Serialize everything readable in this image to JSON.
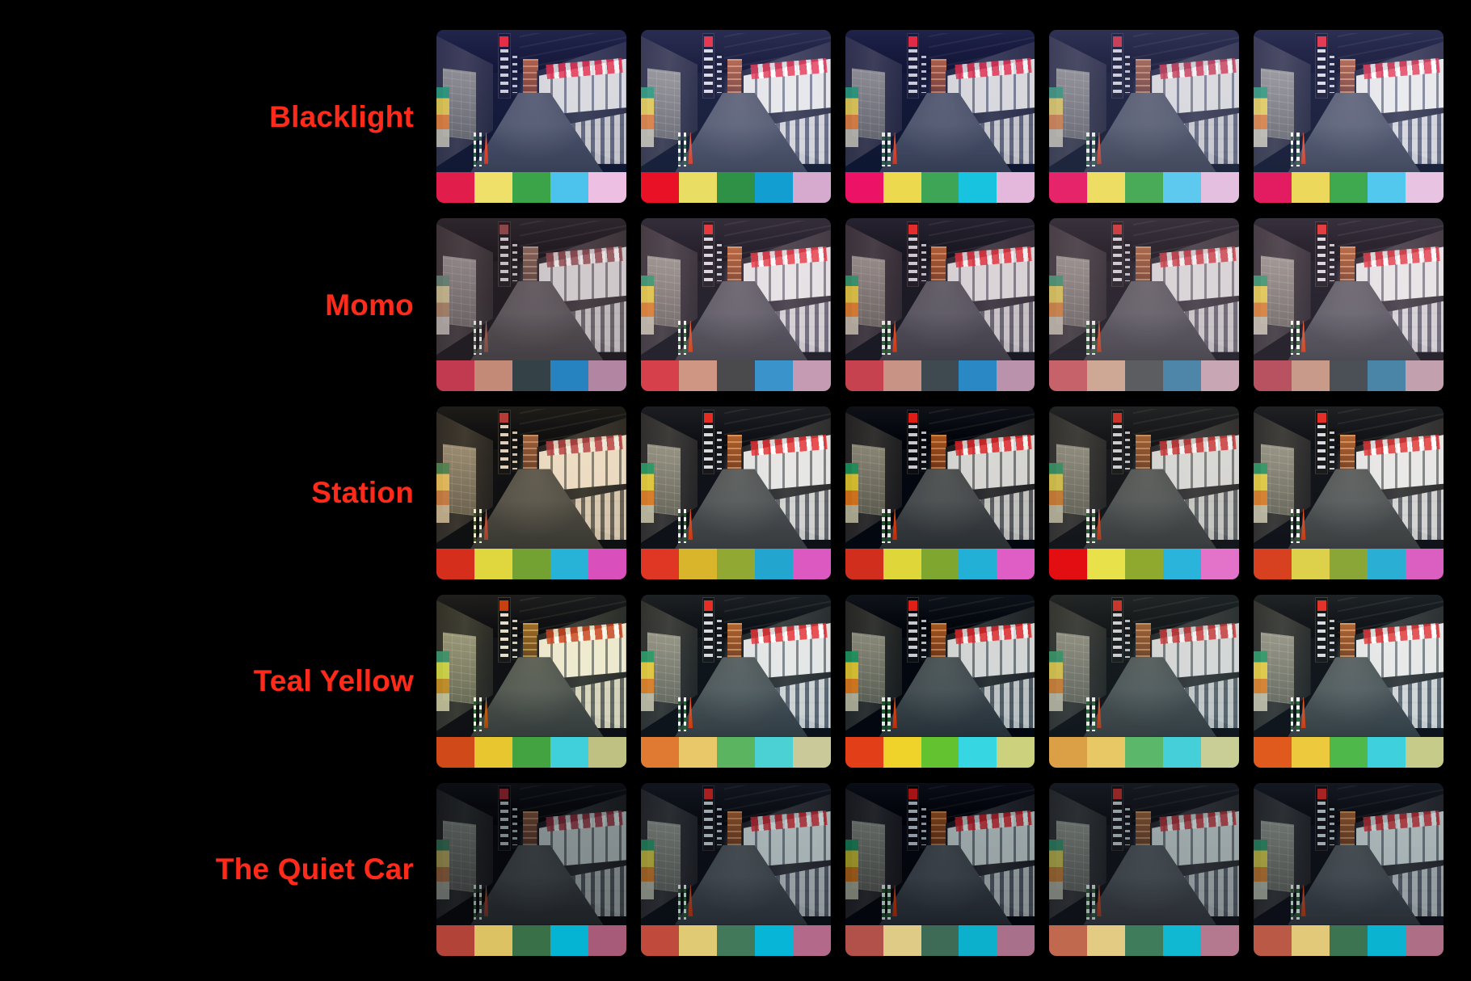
{
  "page": {
    "title": "Colour Preset Comparison Grid",
    "background_color": "#000000",
    "label_color": "#ff2a1a",
    "columns": 5,
    "rows": 5
  },
  "photo": {
    "subject": "japanese-shopping-arcade-alley-at-night",
    "description": "Narrow covered shopping street at night with vertical Japanese signage, shuttered storefronts, traffic cones and a wet asphalt road receding to a lit vanishing point."
  },
  "presets": [
    {
      "label": "Blacklight",
      "id": "blacklight",
      "row_class": "row-blacklight",
      "variants": [
        {
          "swatches": [
            "#e01d4b",
            "#efe069",
            "#3ba348",
            "#4cc3ec",
            "#edbfe3"
          ]
        },
        {
          "swatches": [
            "#e81126",
            "#e9dd63",
            "#2f9145",
            "#129ed1",
            "#d6aace"
          ]
        },
        {
          "swatches": [
            "#ec1266",
            "#edd94e",
            "#3da555",
            "#18c3e0",
            "#e3b8dc"
          ]
        },
        {
          "swatches": [
            "#e5246a",
            "#eedd63",
            "#49ab57",
            "#5ec9ef",
            "#e5bfe0"
          ]
        },
        {
          "swatches": [
            "#e31c62",
            "#ecd95c",
            "#3fa94f",
            "#52c8ee",
            "#e9c3e2"
          ]
        }
      ]
    },
    {
      "label": "Momo",
      "id": "momo",
      "row_class": "row-momo",
      "variants": [
        {
          "swatches": [
            "#c23a50",
            "#c28a77",
            "#344247",
            "#2683bf",
            "#b286a3"
          ]
        },
        {
          "swatches": [
            "#d6404a",
            "#cf9684",
            "#4a4a4c",
            "#3b93cc",
            "#c49bb2"
          ]
        },
        {
          "swatches": [
            "#c7424f",
            "#c89384",
            "#3e4a50",
            "#2a88c4",
            "#bb92ab"
          ]
        },
        {
          "swatches": [
            "#c5626a",
            "#cfa795",
            "#5c5d60",
            "#4d86a9",
            "#c9a6b4"
          ]
        },
        {
          "swatches": [
            "#b85260",
            "#c79a8a",
            "#4a5055",
            "#4a84a6",
            "#c2a0ad"
          ]
        }
      ]
    },
    {
      "label": "Station",
      "id": "station",
      "row_class": "row-station",
      "variants": [
        {
          "swatches": [
            "#d62e1d",
            "#e0d63e",
            "#74a232",
            "#27b2d8",
            "#d94fbc"
          ]
        },
        {
          "swatches": [
            "#e03624",
            "#d9b52c",
            "#91a832",
            "#22a5cf",
            "#dd59c2"
          ]
        },
        {
          "swatches": [
            "#d22e1e",
            "#dfd63a",
            "#7fa62f",
            "#22b0d6",
            "#df5ec6"
          ]
        },
        {
          "swatches": [
            "#e20e12",
            "#e8e14a",
            "#8fa82e",
            "#2ab4dc",
            "#e273c9"
          ]
        },
        {
          "swatches": [
            "#d7411f",
            "#ddd04a",
            "#8aa636",
            "#2aaed4",
            "#da5fc0"
          ]
        }
      ]
    },
    {
      "label": "Teal Yellow",
      "id": "teal-yellow",
      "row_class": "row-tealyellow",
      "variants": [
        {
          "swatches": [
            "#d04a19",
            "#e7c62f",
            "#43a340",
            "#3fd0dc",
            "#bfc183"
          ]
        },
        {
          "swatches": [
            "#e07a33",
            "#e8c868",
            "#5bb560",
            "#4bd0d4",
            "#c9c99a"
          ]
        },
        {
          "swatches": [
            "#e23f18",
            "#efd32a",
            "#63c22f",
            "#36d6e2",
            "#ccd17e"
          ]
        },
        {
          "swatches": [
            "#dba045",
            "#e8c765",
            "#5bb86a",
            "#45cfd8",
            "#c9cd96"
          ]
        },
        {
          "swatches": [
            "#e05a1e",
            "#edc93d",
            "#4fb84a",
            "#3fd0dd",
            "#c6cb8a"
          ]
        }
      ]
    },
    {
      "label": "The Quiet Car",
      "id": "the-quiet-car",
      "row_class": "row-quietcar",
      "variants": [
        {
          "swatches": [
            "#b14338",
            "#ddc263",
            "#3a7048",
            "#05b4d3",
            "#a85b78"
          ]
        },
        {
          "swatches": [
            "#c04a3c",
            "#e0ca74",
            "#41795a",
            "#07b6d6",
            "#b3698a"
          ]
        },
        {
          "swatches": [
            "#b2504a",
            "#e0cb86",
            "#3d6b55",
            "#0cb0cc",
            "#a9708c"
          ]
        },
        {
          "swatches": [
            "#c0694f",
            "#e3cb84",
            "#3f7c5b",
            "#10b8d2",
            "#b5798f"
          ]
        },
        {
          "swatches": [
            "#ba5a46",
            "#e2c97a",
            "#3c7452",
            "#0ab3d0",
            "#ae6e86"
          ]
        }
      ]
    }
  ]
}
